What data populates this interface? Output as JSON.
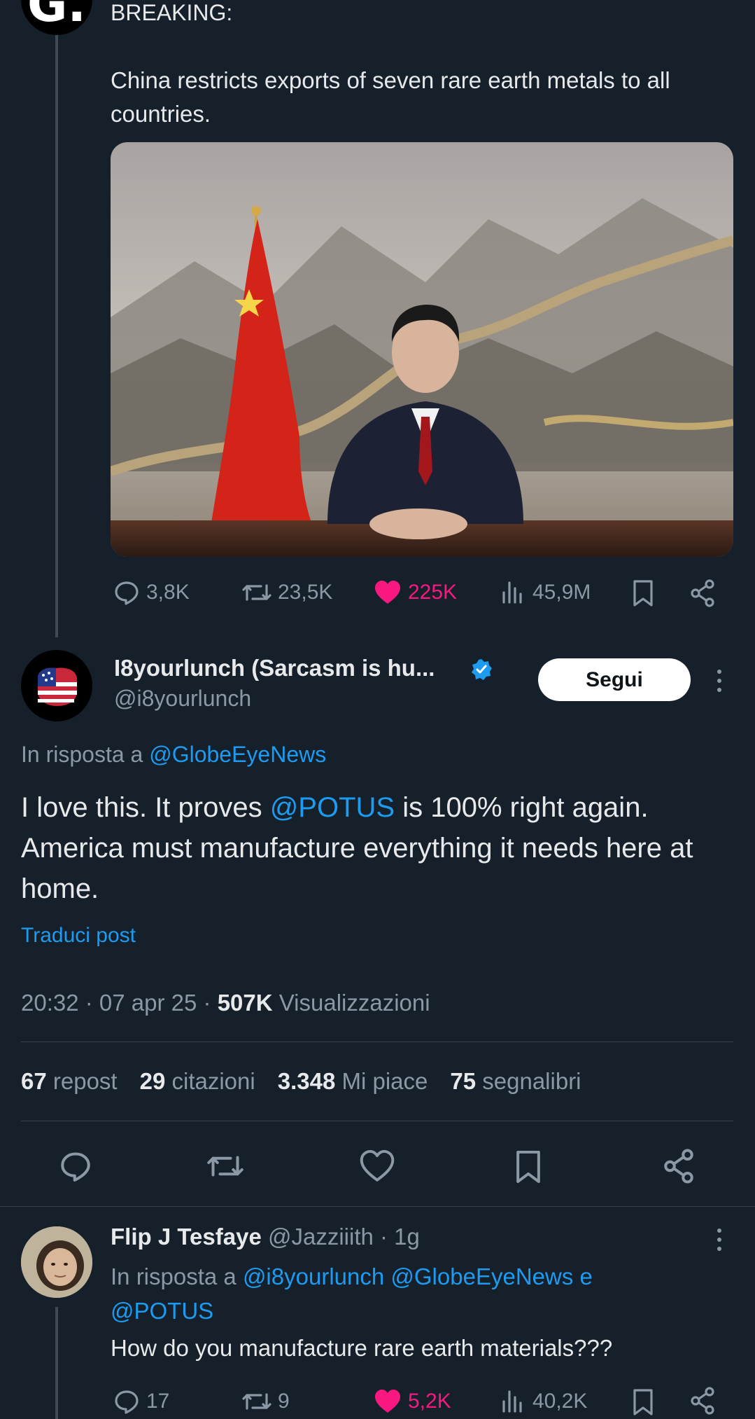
{
  "post1": {
    "text_head": "BREAKING:",
    "text_body": "China restricts exports of seven rare earth metals to all countries.",
    "image_alt": "Xi Jinping seated at desk in front of Great Wall painting and Chinese flag",
    "stats": {
      "replies": "3,8K",
      "reposts": "23,5K",
      "likes": "225K",
      "views": "45,9M"
    }
  },
  "post2": {
    "author_name": "I8yourlunch (Sarcasm is hu...",
    "author_handle": "@i8yourlunch",
    "follow_label": "Segui",
    "reply_prefix": "In risposta a",
    "reply_to": "@GlobeEyeNews",
    "text_a": "I love this. It proves ",
    "text_mention": "@POTUS",
    "text_b": " is 100% right again. America must manufacture everything it needs here at home.",
    "translate": "Traduci post",
    "time": "20:32 · 07 apr 25 · ",
    "views_count": "507K",
    "views_label": " Visualizzazioni",
    "counts": [
      {
        "num": "67",
        "label": " repost"
      },
      {
        "num": "29",
        "label": " citazioni"
      },
      {
        "num": "3.348",
        "label": " Mi piace"
      },
      {
        "num": "75",
        "label": " segnalibri"
      }
    ]
  },
  "post3": {
    "author_name": "Flip J Tesfaye",
    "author_handle": "@Jazziiith",
    "age": " · 1g",
    "reply_prefix": "In risposta a ",
    "reply_to_1": "@i8yourlunch",
    "reply_to_2": "@GlobeEyeNews",
    "reply_and": " e",
    "reply_to_3": "@POTUS",
    "text": "How do you manufacture rare earth materials???",
    "stats": {
      "replies": "17",
      "reposts": "9",
      "likes": "5,2K",
      "views": "40,2K"
    }
  },
  "colors": {
    "background": "#15202b",
    "link": "#1d9bf0",
    "like": "#f91880",
    "muted": "#8b98a5"
  }
}
